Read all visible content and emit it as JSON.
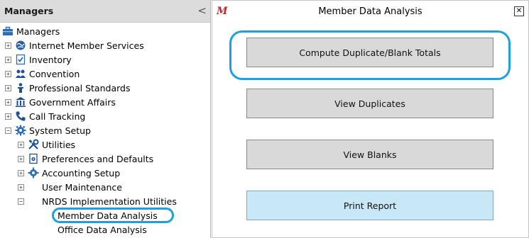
{
  "nav": {
    "title": "Managers",
    "collapse_glyph": "<",
    "tree": [
      {
        "label": "Managers",
        "icon": "briefcase-icon",
        "expander": "",
        "level": 0
      },
      {
        "label": "Internet Member Services",
        "icon": "globe-icon",
        "expander": "+",
        "level": 1
      },
      {
        "label": "Inventory",
        "icon": "checklist-icon",
        "expander": "+",
        "level": 1
      },
      {
        "label": "Convention",
        "icon": "people-icon",
        "expander": "+",
        "level": 1
      },
      {
        "label": "Professional Standards",
        "icon": "podium-icon",
        "expander": "+",
        "level": 1
      },
      {
        "label": "Government Affairs",
        "icon": "building-icon",
        "expander": "+",
        "level": 1
      },
      {
        "label": "Call Tracking",
        "icon": "phone-icon",
        "expander": "+",
        "level": 1
      },
      {
        "label": "System Setup",
        "icon": "gear-icon",
        "expander": "−",
        "level": 1
      },
      {
        "label": "Utilities",
        "icon": "tools-icon",
        "expander": "+",
        "level": 2
      },
      {
        "label": "Preferences and Defaults",
        "icon": "settings-doc-icon",
        "expander": "+",
        "level": 2
      },
      {
        "label": "Accounting Setup",
        "icon": "gear-icon",
        "expander": "+",
        "level": 2
      },
      {
        "label": "User Maintenance",
        "icon": "",
        "expander": "+",
        "level": 2
      },
      {
        "label": "NRDS Implementation Utilities",
        "icon": "",
        "expander": "−",
        "level": 2
      },
      {
        "label": "Member Data Analysis",
        "icon": "",
        "expander": "",
        "level": 3
      },
      {
        "label": "Office Data Analysis",
        "icon": "",
        "expander": "",
        "level": 3
      }
    ]
  },
  "dialog": {
    "logo": "M",
    "title": "Member Data Analysis",
    "close": "✕",
    "buttons": [
      {
        "label": "Compute Duplicate/Blank Totals"
      },
      {
        "label": "View Duplicates"
      },
      {
        "label": "View Blanks"
      },
      {
        "label": "Print Report"
      }
    ]
  },
  "colors": {
    "highlight_outline": "#1ea0e0",
    "logo_red": "#c0282d",
    "button_gray": "#d9d9d9",
    "button_blue": "#c8e8f8"
  }
}
